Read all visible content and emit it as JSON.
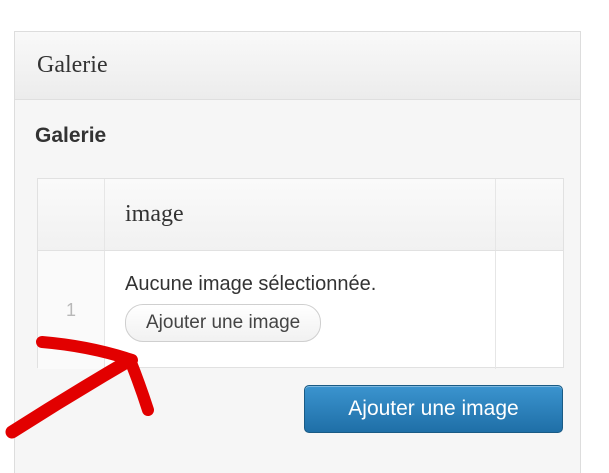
{
  "panel": {
    "title": "Galerie",
    "field_label": "Galerie"
  },
  "table": {
    "column_header": "image",
    "rows": [
      {
        "order": "1",
        "empty_text": "Aucune image sélectionnée.",
        "button_label": "Ajouter une image"
      }
    ]
  },
  "add_row_button": "Ajouter une image",
  "colors": {
    "primary": "#2a7fbd",
    "annotation": "#e20000"
  },
  "annotation": {
    "icon": "red-arrow-icon"
  }
}
